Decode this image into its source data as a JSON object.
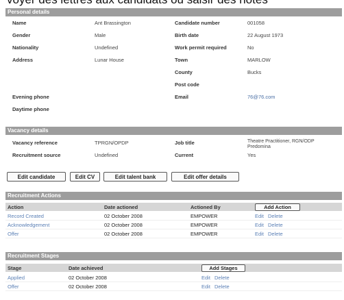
{
  "banner": "voyer des lettres aux candidats ou saisir des notes",
  "personal": {
    "title": "Personal details",
    "rows": [
      {
        "l1": "Name",
        "v1": "Ant Brassington",
        "l2": "Candidate number",
        "v2": "001058"
      },
      {
        "l1": "Gender",
        "v1": "Male",
        "l2": "Birth date",
        "v2": "22 August 1973"
      },
      {
        "l1": "Nationality",
        "v1": "Undefined",
        "l2": "Work permit required",
        "v2": "No"
      },
      {
        "l1": "Address",
        "v1": "Lunar House",
        "l2": "Town",
        "v2": "MARLOW"
      },
      {
        "l1": "",
        "v1": "",
        "l2": "County",
        "v2": "Bucks"
      },
      {
        "l1": "",
        "v1": "",
        "l2": "Post code",
        "v2": ""
      },
      {
        "l1": "Evening phone",
        "v1": "",
        "l2": "Email",
        "v2": "76@76.com"
      },
      {
        "l1": "Daytime phone",
        "v1": "",
        "l2": "",
        "v2": ""
      }
    ]
  },
  "vacancy": {
    "title": "Vacancy details",
    "rows": [
      {
        "l1": "Vacancy reference",
        "v1": "TPRGN/OPDP",
        "l2": "Job title",
        "v2": "Theatre Practitioner, RGN/ODP",
        "v2b": "Predomina"
      },
      {
        "l1": "Recruitment source",
        "v1": "Undefined",
        "l2": "Current",
        "v2": "Yes"
      }
    ]
  },
  "buttons": {
    "edit_candidate": "Edit candidate",
    "edit_cv": "Edit CV",
    "edit_talent": "Edit talent bank",
    "edit_offer": "Edit offer details"
  },
  "actions": {
    "title": "Recruitment Actions",
    "headers": {
      "action": "Action",
      "date": "Date actioned",
      "by": "Actioned By"
    },
    "add_label": "Add Action",
    "rows": [
      {
        "action": "Record Created",
        "date": "02 October 2008",
        "by": "EMPOWER",
        "edit": "Edit",
        "del": "Delete"
      },
      {
        "action": "Acknowledgement",
        "date": "02 October 2008",
        "by": "EMPOWER",
        "edit": "Edit",
        "del": "Delete"
      },
      {
        "action": "Offer",
        "date": "02 October 2008",
        "by": "EMPOWER",
        "edit": "Edit",
        "del": "Delete"
      }
    ]
  },
  "stages": {
    "title": "Recruitment Stages",
    "headers": {
      "stage": "Stage",
      "date": "Date achieved"
    },
    "add_label": "Add Stages",
    "rows": [
      {
        "stage": "Applied",
        "date": "02 October 2008",
        "edit": "Edit",
        "del": "Delete"
      },
      {
        "stage": "Offer",
        "date": "02 October 2008",
        "edit": "Edit",
        "del": "Delete"
      }
    ]
  }
}
